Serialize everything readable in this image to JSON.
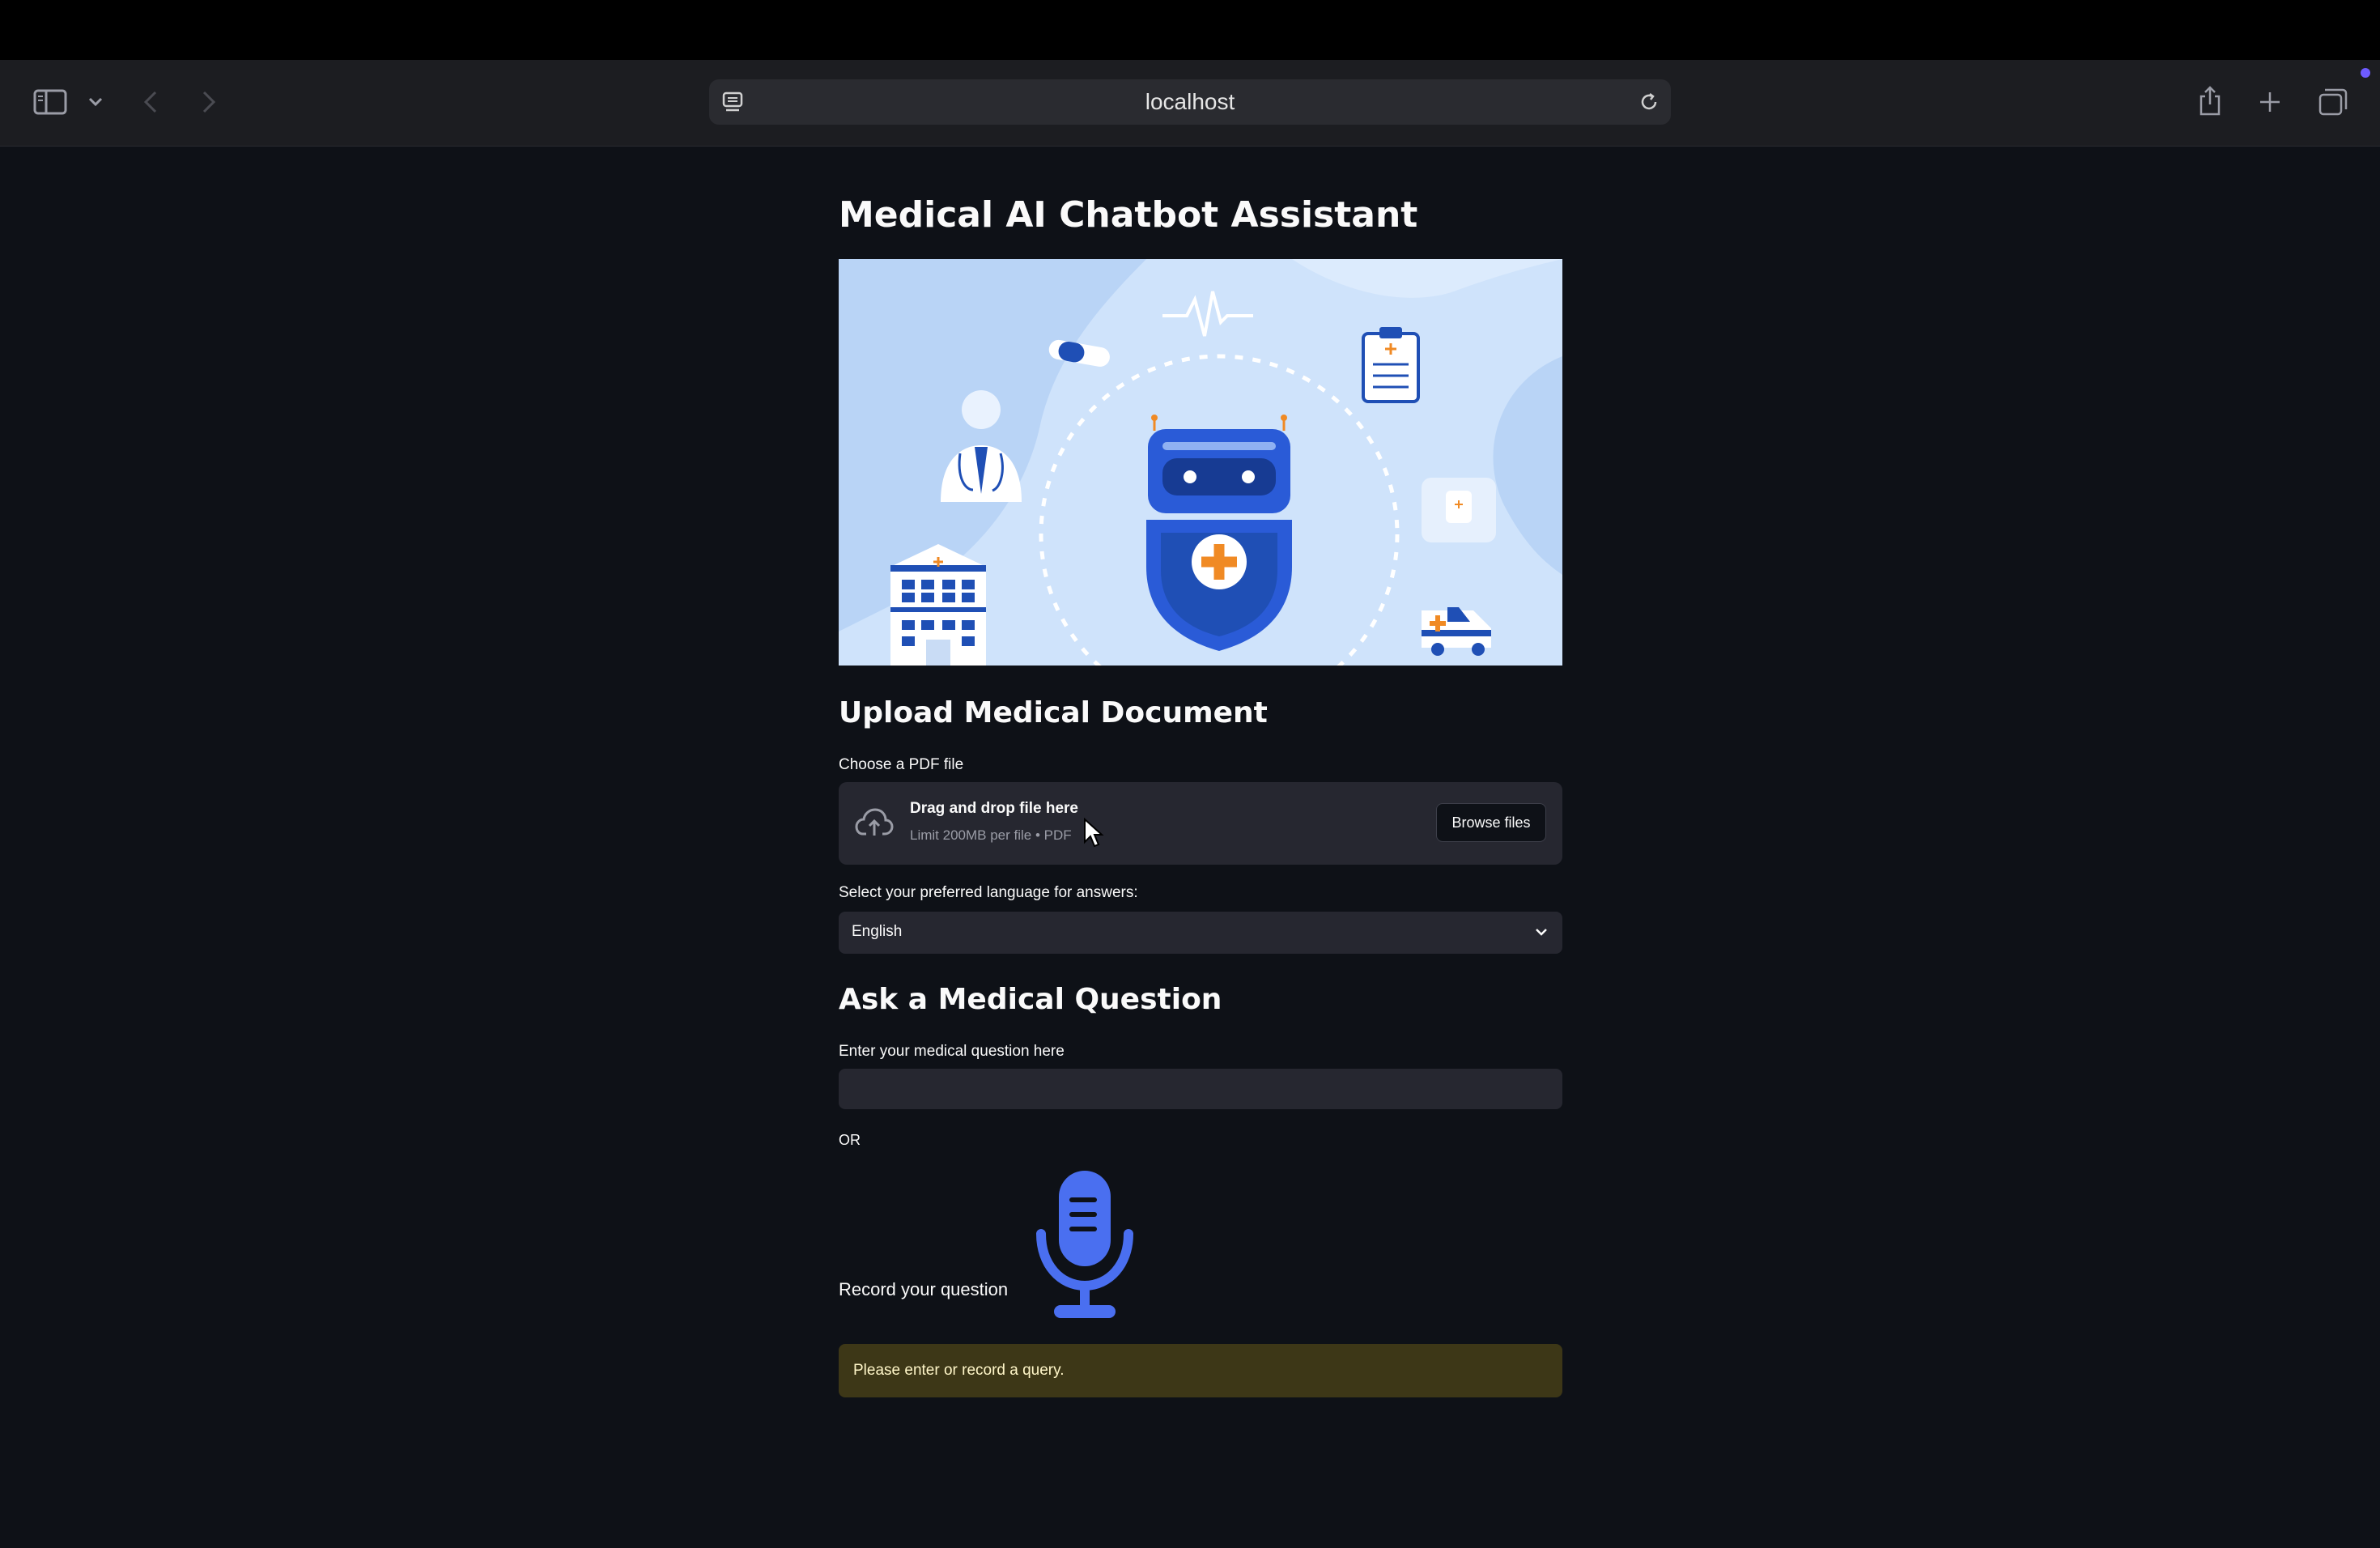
{
  "browser": {
    "url": "localhost"
  },
  "page": {
    "title": "Medical AI Chatbot Assistant"
  },
  "upload": {
    "heading": "Upload Medical Document",
    "label": "Choose a PDF file",
    "drag_text": "Drag and drop file here",
    "limit_text": "Limit 200MB per file • PDF",
    "browse_label": "Browse files"
  },
  "language": {
    "label": "Select your preferred language for answers:",
    "selected": "English"
  },
  "question": {
    "heading": "Ask a Medical Question",
    "label": "Enter your medical question here",
    "value": "",
    "or_text": "OR",
    "record_label": "Record your question"
  },
  "alert": {
    "text": "Please enter or record a query."
  },
  "colors": {
    "background": "#0e1117",
    "widget": "#262730",
    "warning_bg": "#3d3717",
    "accent_blue": "#2a5bd7",
    "mic_blue": "#4a6ff0",
    "hero_bg": "#cfe3fb"
  }
}
